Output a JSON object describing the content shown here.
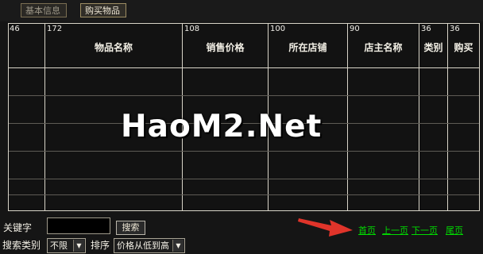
{
  "tabs": [
    {
      "label": "基本信息"
    },
    {
      "label": "购买物品"
    }
  ],
  "table": {
    "widths": [
      "46",
      "172",
      "108",
      "100",
      "90",
      "36",
      "36"
    ],
    "headers": [
      "",
      "物品名称",
      "销售价格",
      "所在店铺",
      "店主名称",
      "类别",
      "购买"
    ]
  },
  "watermark": "HaoM2.Net",
  "search": {
    "keyword_label": "关键字",
    "keyword_value": "",
    "button_label": "搜索",
    "category_label": "搜索类别",
    "category_value": "不限",
    "sort_label": "排序",
    "sort_value": "价格从低到高"
  },
  "pager": {
    "first": "首页",
    "prev": "上一页",
    "next": "下一页",
    "last": "尾页"
  },
  "colors": {
    "background": "#151515",
    "grid": "#d8d4c8",
    "link": "#00dc00",
    "arrow": "#e0342a"
  }
}
